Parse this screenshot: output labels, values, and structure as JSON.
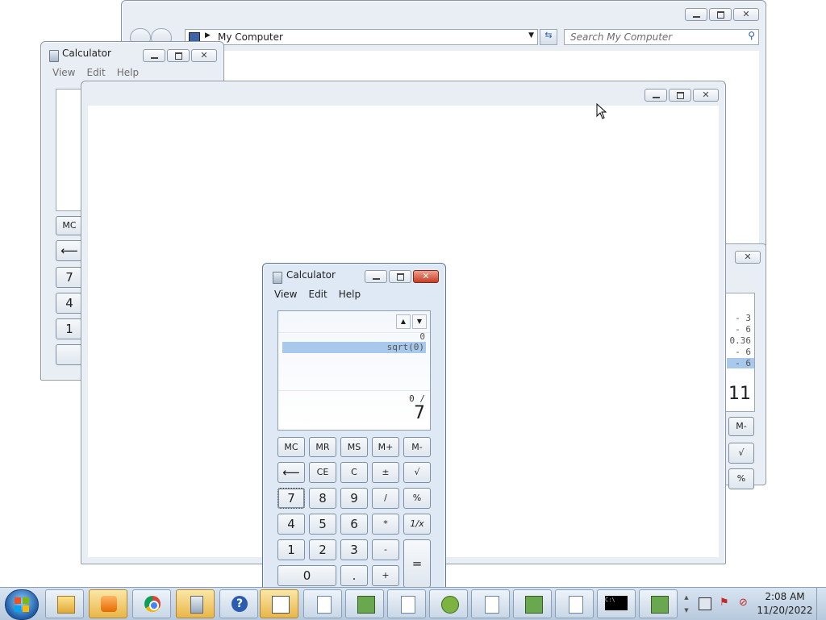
{
  "explorer": {
    "address": "My Computer",
    "search_placeholder": "Search My Computer"
  },
  "calc_back": {
    "title": "Calculator",
    "menu": [
      "View",
      "Edit",
      "Help"
    ],
    "keys": [
      "MC",
      "⟵",
      "7",
      "4",
      "1"
    ]
  },
  "calc_right": {
    "history": [
      "- 3",
      "- 6",
      "0.36",
      "- 6",
      "- 6"
    ],
    "display": "11",
    "keys": [
      "M-",
      "√",
      "%"
    ]
  },
  "calc_front": {
    "title": "Calculator",
    "menu": [
      "View",
      "Edit",
      "Help"
    ],
    "history": [
      "0",
      "sqrt(0)"
    ],
    "expression": "0 /",
    "display": "7",
    "keys": {
      "r1": [
        "MC",
        "MR",
        "MS",
        "M+",
        "M-"
      ],
      "r2": [
        "⟵",
        "CE",
        "C",
        "±",
        "√"
      ],
      "r3": [
        "7",
        "8",
        "9",
        "/",
        "%"
      ],
      "r4": [
        "4",
        "5",
        "6",
        "*",
        "1/x"
      ],
      "r5": [
        "1",
        "2",
        "3",
        "-"
      ],
      "eq": "=",
      "r6": [
        "0",
        ".",
        "+"
      ]
    }
  },
  "taskbar": {
    "time": "2:08 AM",
    "date": "11/20/2022",
    "cmd_icon_text": "C:\\"
  }
}
